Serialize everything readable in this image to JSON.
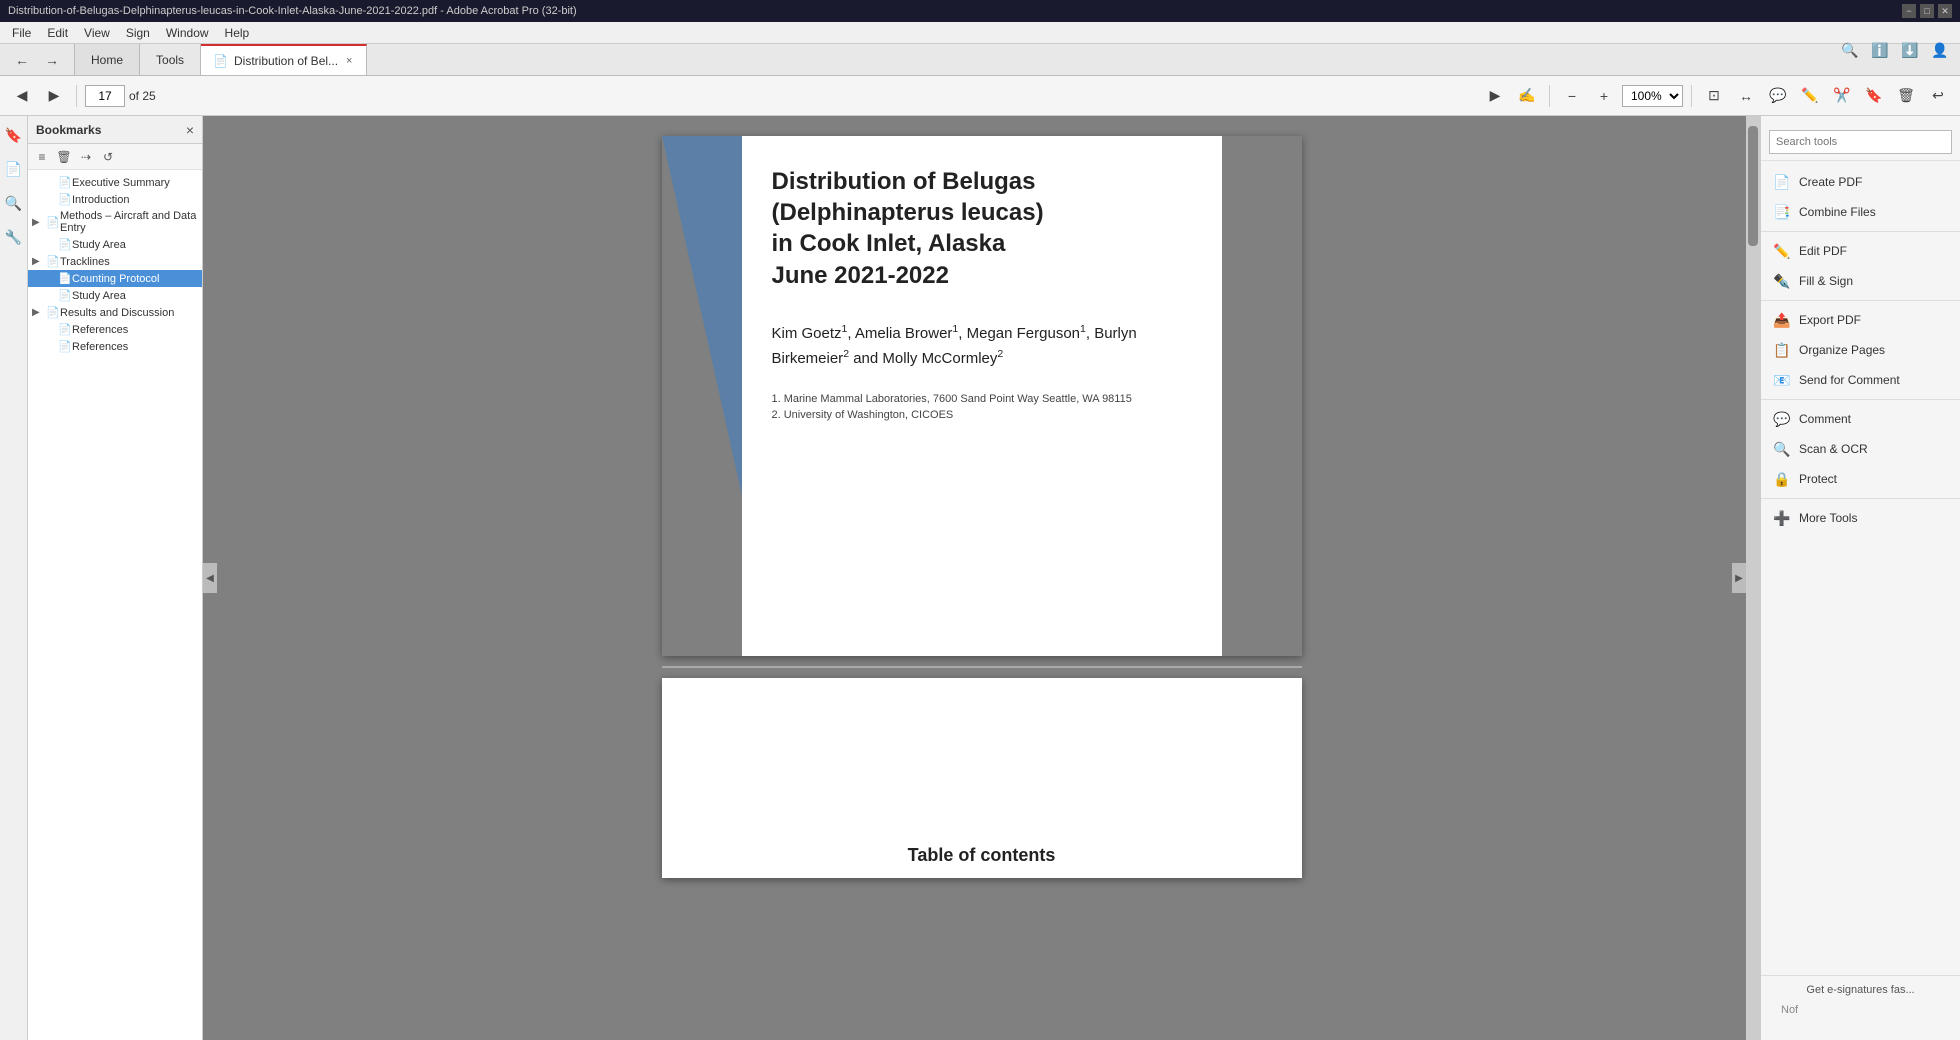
{
  "titlebar": {
    "text": "Distribution-of-Belugas-Delphinapterus-leucas-in-Cook-Inlet-Alaska-June-2021-2022.pdf - Adobe Acrobat Pro (32-bit)",
    "minimize": "−",
    "maximize": "□",
    "close": "✕"
  },
  "menubar": {
    "items": [
      "File",
      "Edit",
      "View",
      "Sign",
      "Window",
      "Help"
    ]
  },
  "tabs": {
    "home": "Home",
    "tools": "Tools",
    "doc": "Distribution of Bel...",
    "close_icon": "×"
  },
  "toolbar": {
    "nav_prev": "◀",
    "nav_next": "▶",
    "page_current": "17",
    "page_total": "of 25",
    "zoom": "100%",
    "zoom_out": "−",
    "zoom_in": "+",
    "select_tool": "▶",
    "hand_tool": "✋",
    "zoom_tool": "🔍"
  },
  "bookmarks": {
    "title": "Bookmarks",
    "close": "×",
    "toolbar_icons": [
      "≡",
      "🗑",
      "⇢",
      "🔁"
    ],
    "items": [
      {
        "id": "exec-summary",
        "label": "Executive Summary",
        "indent": 1,
        "expand": false,
        "selected": false
      },
      {
        "id": "introduction",
        "label": "Introduction",
        "indent": 1,
        "expand": false,
        "selected": false
      },
      {
        "id": "methods",
        "label": "Methods – Aircraft and Data Entry",
        "indent": 0,
        "expand": true,
        "selected": false
      },
      {
        "id": "study-area",
        "label": "Study Area",
        "indent": 1,
        "expand": false,
        "selected": false
      },
      {
        "id": "tracklines",
        "label": "Tracklines",
        "indent": 0,
        "expand": true,
        "selected": false
      },
      {
        "id": "counting",
        "label": "Counting Protocol",
        "indent": 1,
        "expand": false,
        "selected": true
      },
      {
        "id": "study-area2",
        "label": "Study Area",
        "indent": 1,
        "expand": false,
        "selected": false
      },
      {
        "id": "results",
        "label": "Results and Discussion",
        "indent": 0,
        "expand": true,
        "selected": false
      },
      {
        "id": "references",
        "label": "References",
        "indent": 1,
        "expand": false,
        "selected": false
      },
      {
        "id": "references2",
        "label": "References",
        "indent": 1,
        "expand": false,
        "selected": false
      }
    ]
  },
  "pdf": {
    "page1": {
      "title_line1": "Distribution of Belugas",
      "title_line2": "(Delphinapterus leucas)",
      "title_line3": "in Cook Inlet, Alaska",
      "title_line4": "June 2021-2022",
      "authors": "Kim Goetz¹, Amelia Brower¹, Megan Ferguson¹, Burlyn Birkemeier² and Molly McCormley²",
      "affiliation1": "1. Marine Mammal Laboratories, 7600 Sand Point Way Seattle, WA 98115",
      "affiliation2": "2. University of Washington, CICOES"
    },
    "page2": {
      "heading": "Table of contents"
    }
  },
  "right_panel": {
    "search_placeholder": "Search tools",
    "tools": [
      {
        "id": "create-pdf",
        "label": "Create PDF",
        "icon": "📄"
      },
      {
        "id": "combine-files",
        "label": "Combine Files",
        "icon": "📑"
      },
      {
        "id": "edit-pdf",
        "label": "Edit PDF",
        "icon": "✏️"
      },
      {
        "id": "fill-sign",
        "label": "Fill & Sign",
        "icon": "✒️"
      },
      {
        "id": "export-pdf",
        "label": "Export PDF",
        "icon": "📤"
      },
      {
        "id": "organize-pages",
        "label": "Organize Pages",
        "icon": "📋"
      },
      {
        "id": "send-for-comment",
        "label": "Send for Comment",
        "icon": "📧"
      },
      {
        "id": "comment",
        "label": "Comment",
        "icon": "💬"
      },
      {
        "id": "scan-ocr",
        "label": "Scan & OCR",
        "icon": "🔍"
      },
      {
        "id": "protect",
        "label": "Protect",
        "icon": "🔒"
      },
      {
        "id": "more-tools",
        "label": "More Tools",
        "icon": "➕"
      }
    ],
    "bottom_label": "Get e-signatures fas...",
    "nof_label": "Nof"
  },
  "top_right_icons": [
    "🔍",
    "ℹ️",
    "⬇️",
    "👤"
  ]
}
